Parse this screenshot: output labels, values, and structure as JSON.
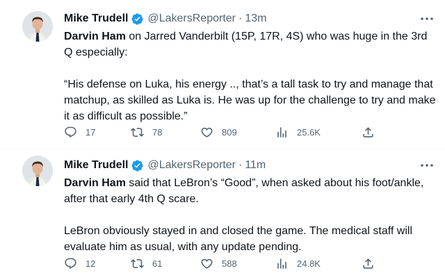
{
  "colors": {
    "text": "#0f1419",
    "secondary": "#536471",
    "verified": "#1d9bf0",
    "divider": "#eff3f4"
  },
  "tweets": [
    {
      "author": "Mike Trudell",
      "handle": "@LakersReporter",
      "separator": "·",
      "time": "13m",
      "verified_icon": "verified-badge-icon",
      "more_icon": "more-horizontal-icon",
      "lead_bold": "Darvin Ham",
      "lead_rest": " on Jarred Vanderbilt (15P, 17R, 4S) who was huge in the 3rd Q especially:",
      "paragraph2": "“His defense on Luka, his energy .., that’s a tall task to try and manage that matchup, as skilled as Luka is. He was up for the challenge to try and make it as difficult as possible.”",
      "replies": "17",
      "retweets": "78",
      "likes": "809",
      "views": "25.6K"
    },
    {
      "author": "Mike Trudell",
      "handle": "@LakersReporter",
      "separator": "·",
      "time": "11m",
      "verified_icon": "verified-badge-icon",
      "more_icon": "more-horizontal-icon",
      "lead_bold": "Darvin Ham",
      "lead_rest": " said that LeBron’s “Good”, when asked about his foot/ankle, after that early 4th Q scare.",
      "paragraph2": "LeBron obviously stayed in and closed the game. The medical staff will evaluate him as usual, with any update pending.",
      "replies": "12",
      "retweets": "61",
      "likes": "588",
      "views": "24.8K"
    }
  ],
  "action_icons": [
    "reply-icon",
    "retweet-icon",
    "like-icon",
    "views-icon",
    "share-icon"
  ]
}
